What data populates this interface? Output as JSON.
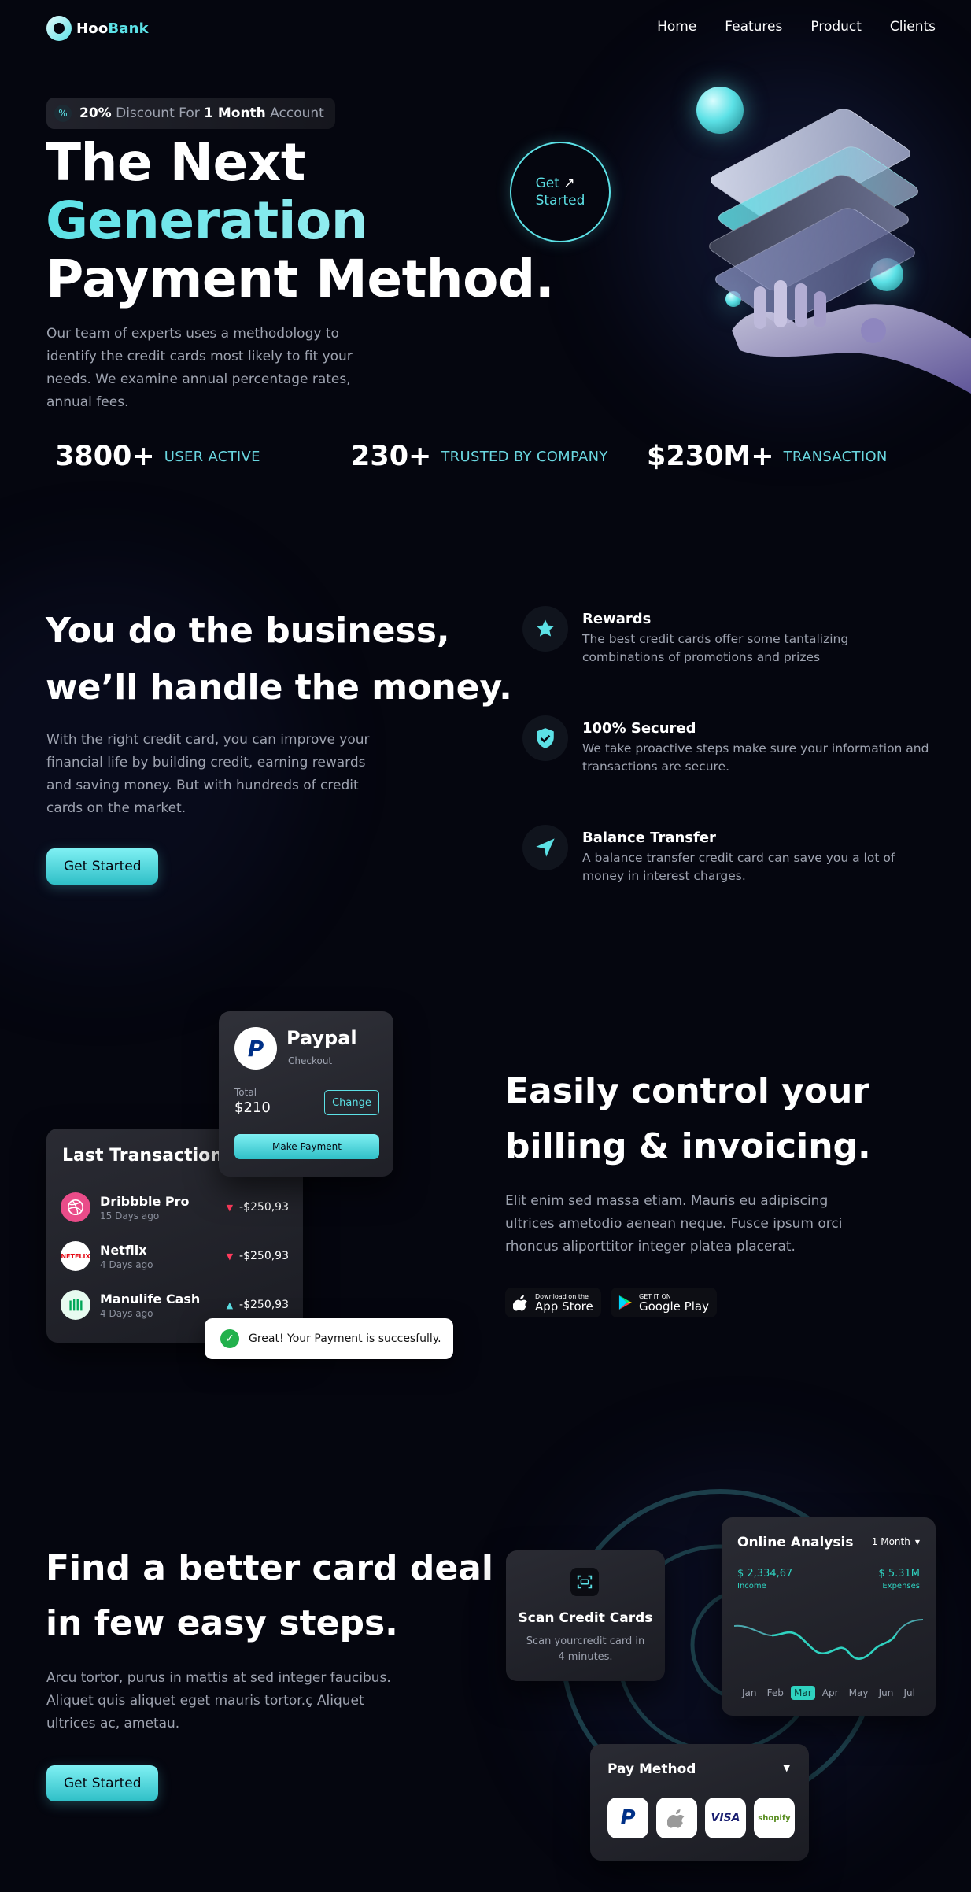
{
  "brand": {
    "name_part1": "Hoo",
    "name_part2": "Bank"
  },
  "nav": {
    "items": [
      "Home",
      "Features",
      "Product",
      "Clients"
    ]
  },
  "hero": {
    "badge_icon": "percent-icon",
    "badge_bold1": "20%",
    "badge_text1": " Discount For ",
    "badge_bold2": "1 Month",
    "badge_text2": " Account",
    "title_line1": "The Next",
    "title_line2": "Generation",
    "title_line3": "Payment Method.",
    "description": "Our team of experts uses a methodology to identify the credit cards most likely to fit your needs. We examine annual percentage rates, annual fees.",
    "circle_button_line1": "Get",
    "circle_button_line2": "Started"
  },
  "stats": [
    {
      "value": "3800+",
      "label": "USER ACTIVE"
    },
    {
      "value": "230+",
      "label": "TRUSTED BY COMPANY"
    },
    {
      "value": "$230M+",
      "label": "TRANSACTION"
    }
  ],
  "business": {
    "title_line1": "You do the business,",
    "title_line2": "we’ll handle the money.",
    "description": "With the right credit card, you can improve your financial life by building credit, earning rewards and saving money. But with hundreds of credit cards on the market.",
    "cta": "Get Started",
    "features": [
      {
        "icon": "star-icon",
        "title": "Rewards",
        "desc": "The best credit cards offer some tantalizing combinations of promotions and prizes"
      },
      {
        "icon": "shield-icon",
        "title": "100% Secured",
        "desc": "We take proactive steps make sure your information and transactions are secure."
      },
      {
        "icon": "send-icon",
        "title": "Balance Transfer",
        "desc": "A balance transfer credit card can save you a lot of money in interest charges."
      }
    ]
  },
  "billing": {
    "paypal": {
      "title": "Paypal",
      "subtitle": "Checkout",
      "total_label": "Total",
      "total_value": "$210",
      "change": "Change",
      "pay": "Make Payment"
    },
    "transactions": {
      "title": "Last Transaction",
      "rows": [
        {
          "name": "Dribbble Pro",
          "date": "15 Days ago",
          "amount": "-$250,93",
          "direction": "down",
          "icon": "dribbble-icon"
        },
        {
          "name": "Netflix",
          "date": "4 Days ago",
          "amount": "-$250,93",
          "direction": "down",
          "icon": "netflix-icon",
          "logo_text": "NETFLIX"
        },
        {
          "name": "Manulife Cash",
          "date": "4 Days ago",
          "amount": "-$250,93",
          "direction": "up",
          "icon": "manulife-icon"
        }
      ]
    },
    "toast": "Great! Your Payment is succesfully.",
    "title_line1": "Easily control your",
    "title_line2": "billing & invoicing.",
    "description": "Elit enim sed massa etiam. Mauris eu adipiscing ultrices ametodio aenean neque. Fusce ipsum orci rhoncus aliporttitor integer platea placerat.",
    "app_store": {
      "small": "Download on the",
      "big": "App Store"
    },
    "google_play": {
      "small": "GET IT ON",
      "big": "Google Play"
    }
  },
  "cards": {
    "title_line1": "Find a better card deal",
    "title_line2": "in few easy steps.",
    "description": "Arcu tortor, purus in mattis at sed integer faucibus. Aliquet quis aliquet eget mauris tortor.ç Aliquet ultrices ac, ametau.",
    "cta": "Get Started",
    "scan": {
      "title": "Scan Credit Cards",
      "desc": "Scan yourcredit card in 4 minutes."
    },
    "analysis": {
      "title": "Online Analysis",
      "period": "1 Month",
      "income_value": "$ 2,334,67",
      "income_label": "Income",
      "expense_value": "$ 5.31M",
      "expense_label": "Expenses",
      "months": [
        "Jan",
        "Feb",
        "Mar",
        "Apr",
        "May",
        "Jun",
        "Jul"
      ],
      "active_month": "Mar"
    },
    "pay_method": {
      "title": "Pay Method",
      "icons": [
        "paypal-icon",
        "apple-icon",
        "visa-icon",
        "shopify-icon"
      ],
      "visa_text": "VISA",
      "shopify_text": "shopify"
    }
  },
  "colors": {
    "accent": "#5ce1e6",
    "background": "#05060f",
    "muted": "#9ea3b0"
  }
}
